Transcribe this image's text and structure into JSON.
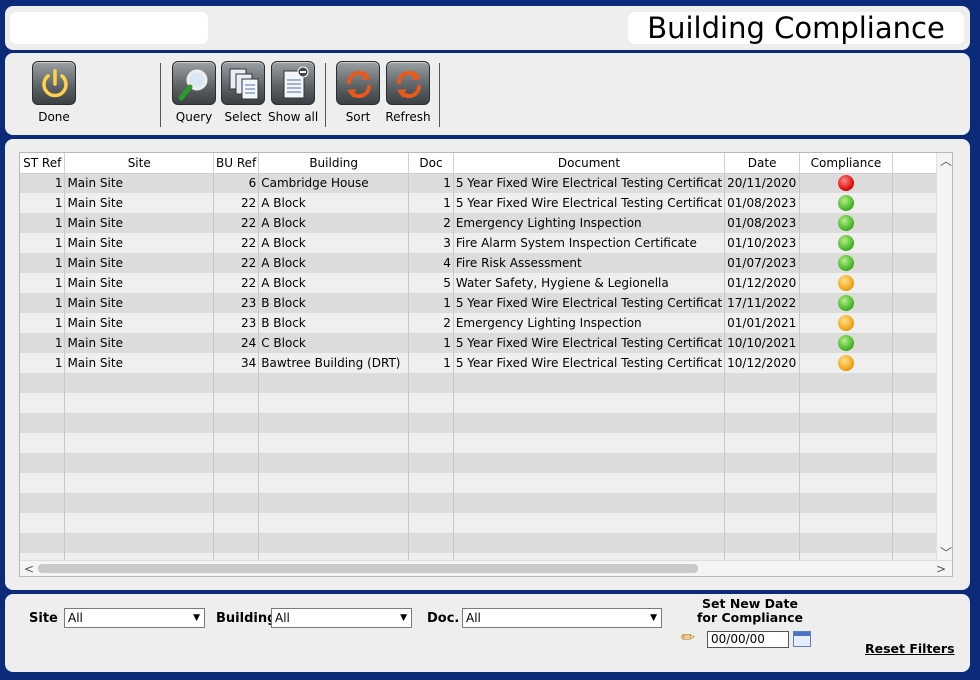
{
  "header": {
    "title": "Building Compliance"
  },
  "toolbar": {
    "done": "Done",
    "query": "Query",
    "select": "Select",
    "show_all": "Show all",
    "sort": "Sort",
    "refresh": "Refresh"
  },
  "table": {
    "columns": [
      "ST Ref",
      "Site",
      "BU Ref",
      "Building",
      "Doc",
      "Document",
      "Date",
      "Compliance"
    ],
    "rows": [
      {
        "st": "1",
        "site": "Main Site",
        "bu": "6",
        "building": "Cambridge House",
        "doc": "1",
        "document": "5 Year Fixed Wire Electrical Testing Certificat",
        "date": "20/11/2020",
        "status": "red"
      },
      {
        "st": "1",
        "site": "Main Site",
        "bu": "22",
        "building": "A Block",
        "doc": "1",
        "document": "5 Year Fixed Wire Electrical Testing Certificat",
        "date": "01/08/2023",
        "status": "green"
      },
      {
        "st": "1",
        "site": "Main Site",
        "bu": "22",
        "building": "A Block",
        "doc": "2",
        "document": "Emergency Lighting Inspection",
        "date": "01/08/2023",
        "status": "green"
      },
      {
        "st": "1",
        "site": "Main Site",
        "bu": "22",
        "building": "A Block",
        "doc": "3",
        "document": "Fire Alarm System Inspection Certificate",
        "date": "01/10/2023",
        "status": "green"
      },
      {
        "st": "1",
        "site": "Main Site",
        "bu": "22",
        "building": "A Block",
        "doc": "4",
        "document": "Fire Risk Assessment",
        "date": "01/07/2023",
        "status": "green"
      },
      {
        "st": "1",
        "site": "Main Site",
        "bu": "22",
        "building": "A Block",
        "doc": "5",
        "document": "Water Safety, Hygiene & Legionella",
        "date": "01/12/2020",
        "status": "amber"
      },
      {
        "st": "1",
        "site": "Main Site",
        "bu": "23",
        "building": "B Block",
        "doc": "1",
        "document": "5 Year Fixed Wire Electrical Testing Certificat",
        "date": "17/11/2022",
        "status": "green"
      },
      {
        "st": "1",
        "site": "Main Site",
        "bu": "23",
        "building": "B Block",
        "doc": "2",
        "document": "Emergency Lighting Inspection",
        "date": "01/01/2021",
        "status": "amber"
      },
      {
        "st": "1",
        "site": "Main Site",
        "bu": "24",
        "building": "C Block",
        "doc": "1",
        "document": "5 Year Fixed Wire Electrical Testing Certificat",
        "date": "10/10/2021",
        "status": "green"
      },
      {
        "st": "1",
        "site": "Main Site",
        "bu": "34",
        "building": "Bawtree Building (DRT)",
        "doc": "1",
        "document": "5 Year Fixed Wire Electrical Testing Certificat",
        "date": "10/12/2020",
        "status": "amber"
      }
    ],
    "empty_rows": 10
  },
  "filters": {
    "site_label": "Site",
    "site_value": "All",
    "building_label": "Building",
    "building_value": "All",
    "doc_label": "Doc.",
    "doc_value": "All",
    "date_title_1": "Set New Date",
    "date_title_2": "for Compliance",
    "date_value": "00/00/00",
    "reset": "Reset Filters"
  },
  "colors": {
    "background": "#0b2a7a",
    "panel": "#eeeeef",
    "row_odd": "#dcdcdc",
    "row_even": "#efefef",
    "status_red": "#e01010",
    "status_green": "#4cb82a",
    "status_amber": "#f0a818"
  },
  "icons": {
    "done": "power-icon",
    "query": "magnifier-icon",
    "select": "documents-icon",
    "show_all": "document-minus-icon",
    "sort": "recycle-arrows-icon",
    "refresh": "recycle-arrows-icon",
    "date_edit": "pencil-icon",
    "calendar": "calendar-icon"
  }
}
